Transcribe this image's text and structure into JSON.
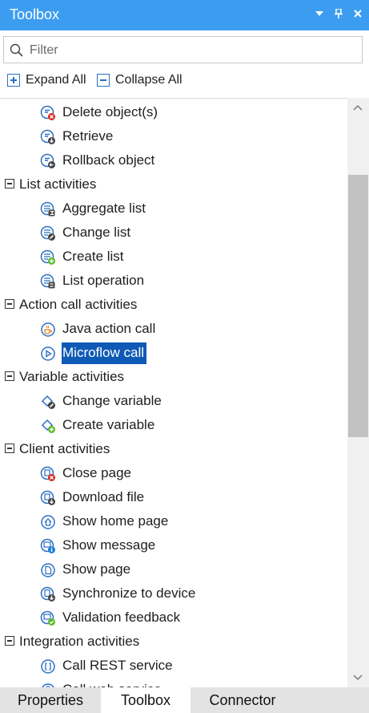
{
  "panel": {
    "title": "Toolbox",
    "controls": [
      "dropdown-icon",
      "pin-icon",
      "close-icon"
    ]
  },
  "filter": {
    "placeholder": "Filter",
    "value": ""
  },
  "actions": {
    "expand_all": "Expand All",
    "collapse_all": "Collapse All"
  },
  "tree": {
    "top_items": [
      {
        "label": "Delete object(s)",
        "icon": "delete-object-icon"
      },
      {
        "label": "Retrieve",
        "icon": "retrieve-icon"
      },
      {
        "label": "Rollback object",
        "icon": "rollback-object-icon"
      }
    ],
    "list_activities": {
      "label": "List activities",
      "items": [
        {
          "label": "Aggregate list",
          "icon": "aggregate-list-icon"
        },
        {
          "label": "Change list",
          "icon": "change-list-icon"
        },
        {
          "label": "Create list",
          "icon": "create-list-icon"
        },
        {
          "label": "List operation",
          "icon": "list-operation-icon"
        }
      ]
    },
    "action_call_activities": {
      "label": "Action call activities",
      "items": [
        {
          "label": "Java action call",
          "icon": "java-action-call-icon"
        },
        {
          "label": "Microflow call",
          "icon": "microflow-call-icon",
          "selected": true
        }
      ]
    },
    "variable_activities": {
      "label": "Variable activities",
      "items": [
        {
          "label": "Change variable",
          "icon": "change-variable-icon"
        },
        {
          "label": "Create variable",
          "icon": "create-variable-icon"
        }
      ]
    },
    "client_activities": {
      "label": "Client activities",
      "items": [
        {
          "label": "Close page",
          "icon": "close-page-icon"
        },
        {
          "label": "Download file",
          "icon": "download-file-icon"
        },
        {
          "label": "Show home page",
          "icon": "show-home-page-icon"
        },
        {
          "label": "Show message",
          "icon": "show-message-icon"
        },
        {
          "label": "Show page",
          "icon": "show-page-icon"
        },
        {
          "label": "Synchronize to device",
          "icon": "synchronize-to-device-icon"
        },
        {
          "label": "Validation feedback",
          "icon": "validation-feedback-icon"
        }
      ]
    },
    "integration_activities": {
      "label": "Integration activities",
      "items": [
        {
          "label": "Call REST service",
          "icon": "call-rest-service-icon"
        },
        {
          "label": "Call web service",
          "icon": "call-web-service-icon"
        }
      ]
    }
  },
  "tabs": [
    {
      "label": "Properties",
      "active": false
    },
    {
      "label": "Toolbox",
      "active": true
    },
    {
      "label": "Connector",
      "active": false
    }
  ],
  "colors": {
    "title_bar": "#3c9df0",
    "selection": "#0f5ab6",
    "icon_blue": "#2c6fc4",
    "badge_red": "#d9261c",
    "badge_green": "#5cb82a",
    "badge_dark": "#444444",
    "badge_info": "#1a7fd6"
  }
}
